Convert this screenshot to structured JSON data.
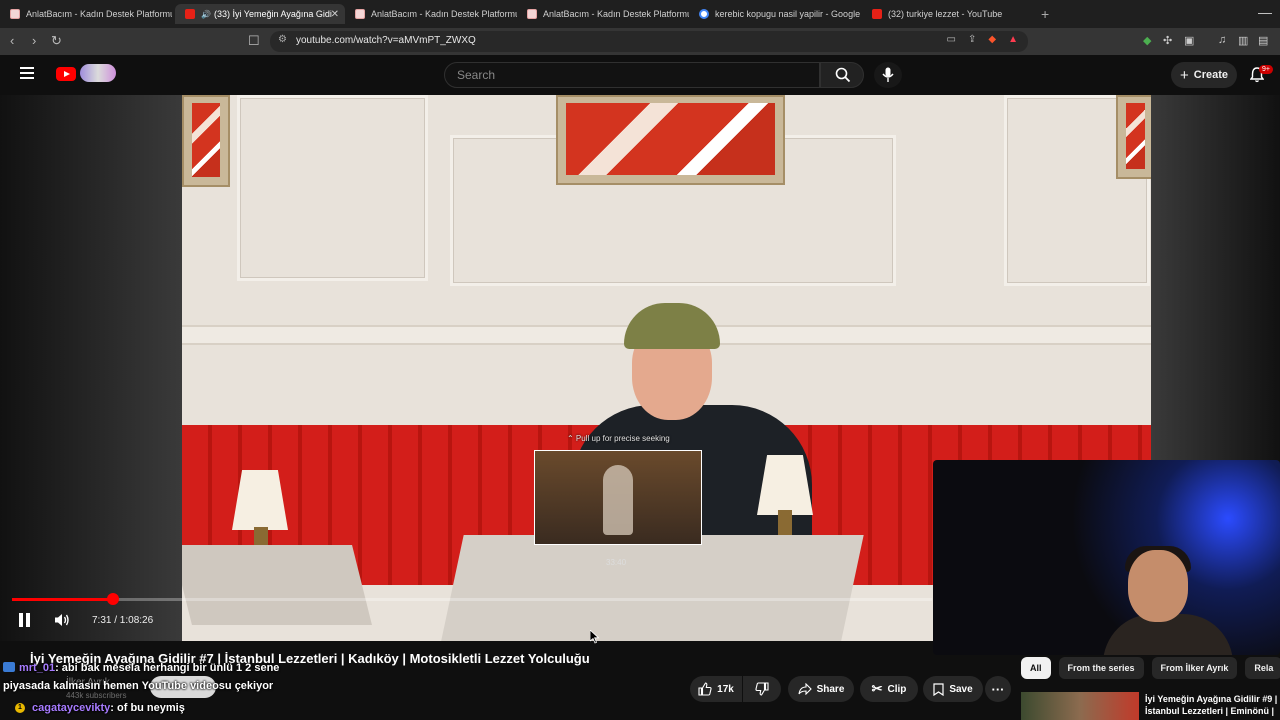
{
  "browser": {
    "tabs": [
      {
        "title": "AnlatBacım - Kadın Destek Platformu",
        "favicon": "pink"
      },
      {
        "title": "(33) İyi Yemeğin Ayağına Gidi",
        "favicon": "youtube",
        "active": true
      },
      {
        "title": "AnlatBacım - Kadın Destek Platformu",
        "favicon": "pink"
      },
      {
        "title": "AnlatBacım - Kadın Destek Platformu",
        "favicon": "pink"
      },
      {
        "title": "kerebic kopugu nasil yapilir - Google",
        "favicon": "google"
      },
      {
        "title": "(32) turkiye lezzet - YouTube",
        "favicon": "youtube"
      }
    ],
    "url": "youtube.com/watch?v=aMVmPT_ZWXQ"
  },
  "youtube": {
    "search_placeholder": "Search",
    "create_label": "Create",
    "notif_badge": "9+"
  },
  "player": {
    "seek_hint": "⌃ Pull up for precise seeking",
    "preview_time": "33:40",
    "time": "7:31 / 1:08:26",
    "progress": 0.11,
    "accent": "#ff0000"
  },
  "video": {
    "title": "İyi Yemeğin Ayağına Gidilir #7 | İstanbul Lezzetleri | Kadıköy | Motosikletli Lezzet Yolculuğu",
    "channel": "İlker Ayrık",
    "subscribers": "443k subscribers",
    "likes": "17k",
    "share": "Share",
    "clip": "Clip",
    "save": "Save"
  },
  "chat": [
    {
      "user": "mrt_01",
      "text": ": abi bak mesela herhangi bir ünlü 1 2 sene"
    },
    {
      "user": "",
      "text": "piyasada kalmasın hemen YouTube videosu çekiyor"
    },
    {
      "user": "cagataycevikty",
      "text": ": of bu neymiş"
    }
  ],
  "chips": [
    "All",
    "From the series",
    "From İlker Ayrık",
    "Rela"
  ],
  "recommended": {
    "title": "İyi Yemeğin Ayağına Gidilir #9 | İstanbul Lezzetleri | Eminönü |"
  }
}
